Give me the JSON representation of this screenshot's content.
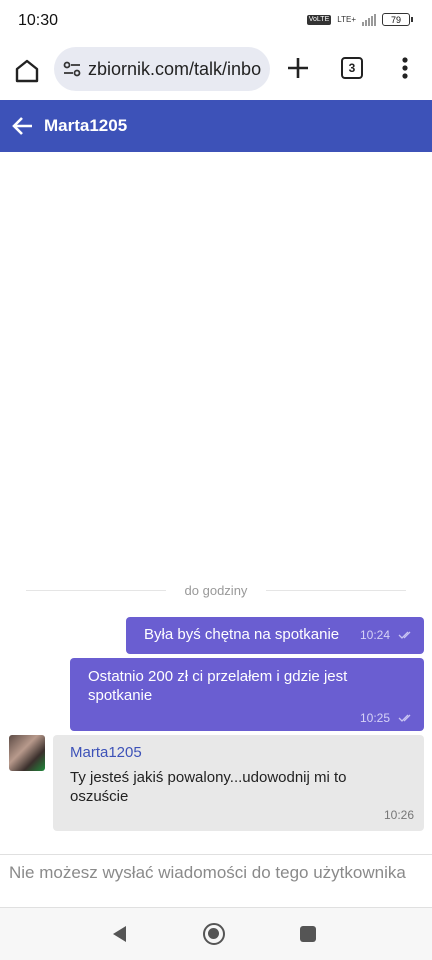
{
  "status_bar": {
    "time": "10:30",
    "network_badge": "VoLTE",
    "network_type": "LTE+",
    "battery": "79"
  },
  "browser": {
    "url": "zbiornik.com/talk/inbo",
    "tab_count": "3"
  },
  "chat": {
    "title": "Marta1205"
  },
  "messages": {
    "divider": "do godziny",
    "items": [
      {
        "direction": "out",
        "text": "Była byś chętna na spotkanie",
        "time": "10:24",
        "status": "read"
      },
      {
        "direction": "out",
        "text": "Ostatnio 200 zł ci przelałem i gdzie jest spotkanie",
        "time": "10:25",
        "status": "read"
      },
      {
        "direction": "in",
        "sender": "Marta1205",
        "text": "Ty jesteś jakiś powalony...udowodnij mi to oszuście",
        "time": "10:26"
      }
    ]
  },
  "composer": {
    "notice": "Nie możesz wysłać wiadomości do tego użytkownika"
  },
  "icons": {
    "home": "home-icon",
    "site_settings": "tune-icon",
    "new_tab": "plus-icon",
    "menu": "more-vert-icon",
    "back": "arrow-left-icon",
    "read": "double-check-icon",
    "nav_back": "triangle-back-icon",
    "nav_home": "circle-home-icon",
    "nav_recents": "square-recents-icon"
  },
  "colors": {
    "header": "#3d52b8",
    "outgoing_bubble": "#6a5ed1",
    "incoming_bubble": "#e8e8e8",
    "url_box": "#e8eaf2"
  }
}
